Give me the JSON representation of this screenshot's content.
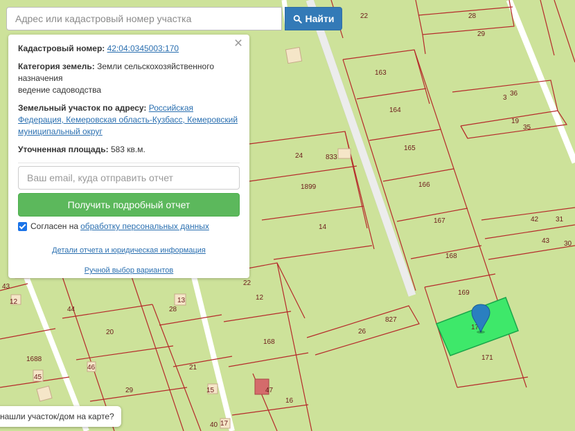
{
  "search": {
    "placeholder": "Адрес или кадастровый номер участка",
    "value": "",
    "button_label": "Найти"
  },
  "info_panel": {
    "cadastral_label": "Кадастровый номер:",
    "cadastral_value": "42:04:0345003:170",
    "category_label": "Категория земель:",
    "category_value": "Земли сельскохозяйственного назначения",
    "category_use": "ведение садоводства",
    "address_label": "Земельный участок по адресу:",
    "address_value": "Российская Федерация, Кемеровская область-Кузбасс, Кемеровский муниципальный округ",
    "area_label": "Уточненная площадь:",
    "area_value": "583 кв.м.",
    "email_placeholder": "Ваш email, куда отправить отчет",
    "email_value": "",
    "report_button": "Получить подробный отчет",
    "consent_checked": true,
    "consent_text": "Согласен на",
    "consent_link": "обработку персональных данных",
    "details_link": "Детали отчета и юридическая информация",
    "manual_link": "Ручной выбор вариантов"
  },
  "help_bubble": "нашли участок/дом на карте?",
  "map": {
    "background_color": "#cde29a",
    "boundary_color": "#b52a2a",
    "selected_color": "#3ee86a",
    "marker_color": "#2a7fc0",
    "plot_numbers": [
      "22",
      "28",
      "29",
      "163",
      "164",
      "165",
      "166",
      "167",
      "168",
      "169",
      "171",
      "170",
      "36",
      "3",
      "19",
      "35",
      "42",
      "31",
      "43",
      "30",
      "24",
      "833",
      "1899",
      "14",
      "22",
      "12",
      "13",
      "28",
      "44",
      "20",
      "43",
      "12",
      "168",
      "26",
      "827",
      "1688",
      "45",
      "46",
      "21",
      "29",
      "15",
      "47",
      "16",
      "40",
      "17"
    ]
  }
}
